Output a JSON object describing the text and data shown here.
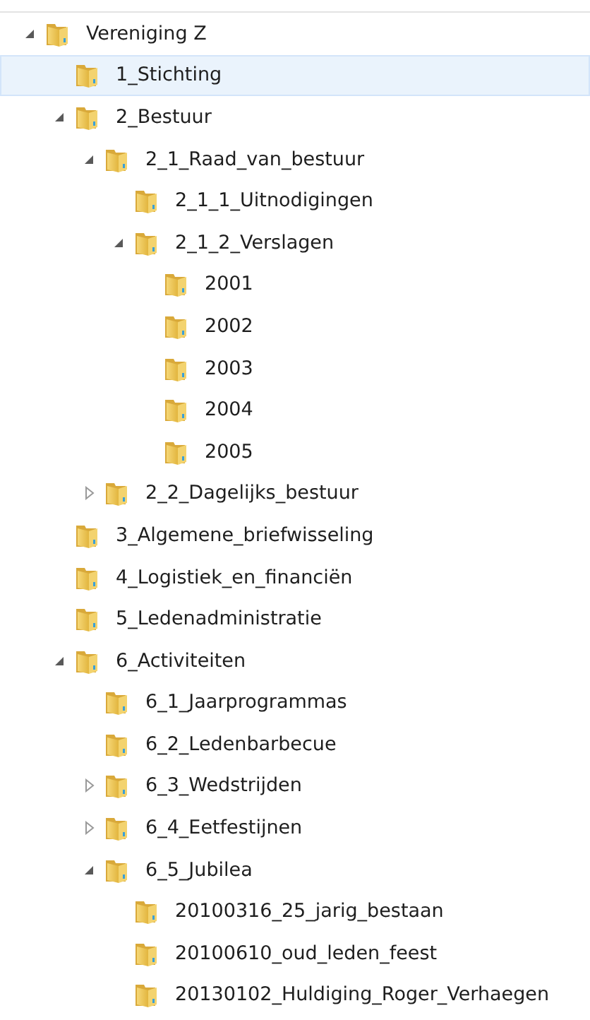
{
  "tree": [
    {
      "label": "Vereniging Z",
      "selected": false,
      "expanded": true,
      "children": [
        {
          "label": "1_Stichting",
          "selected": true
        },
        {
          "label": "2_Bestuur",
          "selected": false,
          "expanded": true,
          "children": [
            {
              "label": "2_1_Raad_van_bestuur",
              "selected": false,
              "expanded": true,
              "children": [
                {
                  "label": "2_1_1_Uitnodigingen",
                  "selected": false
                },
                {
                  "label": "2_1_2_Verslagen",
                  "selected": false,
                  "expanded": true,
                  "children": [
                    {
                      "label": "2001",
                      "selected": false
                    },
                    {
                      "label": "2002",
                      "selected": false
                    },
                    {
                      "label": "2003",
                      "selected": false
                    },
                    {
                      "label": "2004",
                      "selected": false
                    },
                    {
                      "label": "2005",
                      "selected": false
                    }
                  ]
                }
              ]
            },
            {
              "label": "2_2_Dagelijks_bestuur",
              "selected": false,
              "expanded": false
            }
          ]
        },
        {
          "label": "3_Algemene_briefwisseling",
          "selected": false
        },
        {
          "label": "4_Logistiek_en_financiën",
          "selected": false
        },
        {
          "label": "5_Ledenadministratie",
          "selected": false
        },
        {
          "label": "6_Activiteiten",
          "selected": false,
          "expanded": true,
          "children": [
            {
              "label": "6_1_Jaarprogrammas",
              "selected": false
            },
            {
              "label": "6_2_Ledenbarbecue",
              "selected": false
            },
            {
              "label": "6_3_Wedstrijden",
              "selected": false,
              "expanded": false
            },
            {
              "label": "6_4_Eetfestijnen",
              "selected": false,
              "expanded": false
            },
            {
              "label": "6_5_Jubilea",
              "selected": false,
              "expanded": true,
              "children": [
                {
                  "label": "20100316_25_jarig_bestaan",
                  "selected": false
                },
                {
                  "label": "20100610_oud_leden_feest",
                  "selected": false
                },
                {
                  "label": "20130102_Huldiging_Roger_Verhaegen",
                  "selected": false
                }
              ]
            }
          ]
        }
      ]
    }
  ]
}
